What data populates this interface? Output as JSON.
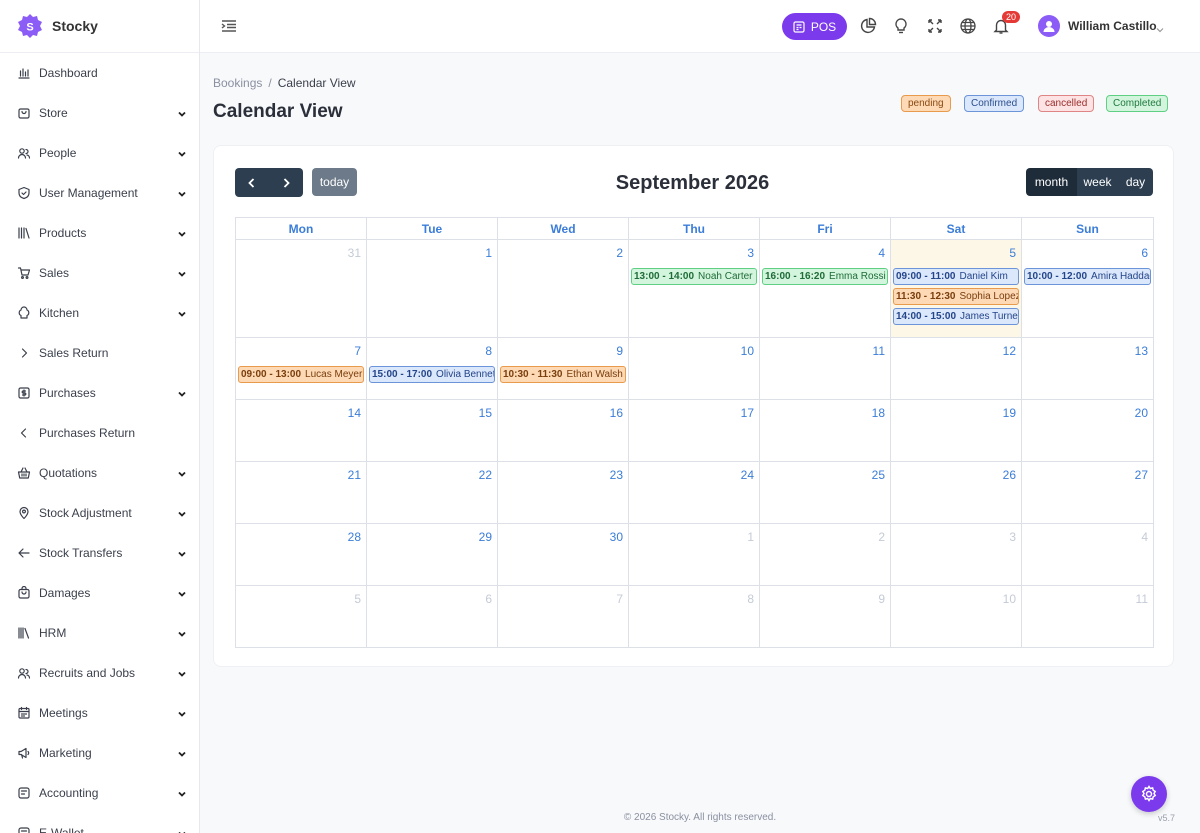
{
  "brand": {
    "name": "Stocky"
  },
  "sidebar": {
    "items": [
      {
        "label": "Dashboard",
        "icon": "chart-bar-icon",
        "chevron": ""
      },
      {
        "label": "Store",
        "icon": "store-icon",
        "chevron": "down"
      },
      {
        "label": "People",
        "icon": "people-icon",
        "chevron": "down"
      },
      {
        "label": "User Management",
        "icon": "shield-icon",
        "chevron": "down"
      },
      {
        "label": "Products",
        "icon": "books-icon",
        "chevron": "down"
      },
      {
        "label": "Sales",
        "icon": "cart-icon",
        "chevron": "down"
      },
      {
        "label": "Kitchen",
        "icon": "chef-hat-icon",
        "chevron": "down"
      },
      {
        "label": "Sales Return",
        "icon": "chevron-right-icon",
        "chevron": ""
      },
      {
        "label": "Purchases",
        "icon": "receipt-icon",
        "chevron": "down"
      },
      {
        "label": "Purchases Return",
        "icon": "chevron-left-icon",
        "chevron": ""
      },
      {
        "label": "Quotations",
        "icon": "basket-icon",
        "chevron": "down"
      },
      {
        "label": "Stock Adjustment",
        "icon": "location-pin-icon",
        "chevron": "down"
      },
      {
        "label": "Stock Transfers",
        "icon": "arrow-left-icon",
        "chevron": "down"
      },
      {
        "label": "Damages",
        "icon": "bag-icon",
        "chevron": "down"
      },
      {
        "label": "HRM",
        "icon": "library-icon",
        "chevron": "down"
      },
      {
        "label": "Recruits and Jobs",
        "icon": "people-icon",
        "chevron": "down"
      },
      {
        "label": "Meetings",
        "icon": "calendar-icon",
        "chevron": "down"
      },
      {
        "label": "Marketing",
        "icon": "megaphone-icon",
        "chevron": "down"
      },
      {
        "label": "Accounting",
        "icon": "wallet-icon",
        "chevron": "down"
      },
      {
        "label": "E-Wallet",
        "icon": "wallet-icon",
        "chevron": "down"
      }
    ]
  },
  "topbar": {
    "pos_label": "POS",
    "notifications_count": "20",
    "user_name": "William Castillo"
  },
  "breadcrumb": {
    "parent": "Bookings",
    "separator": "/",
    "current": "Calendar View"
  },
  "page": {
    "title": "Calendar View"
  },
  "legend": [
    {
      "label": "pending",
      "bg": "#fdd9b5",
      "border": "#e89a4d",
      "color": "#8a4a12"
    },
    {
      "label": "Confirmed",
      "bg": "#dbe7fb",
      "border": "#6c94d8",
      "color": "#2a4f8f"
    },
    {
      "label": "cancelled",
      "bg": "#fde3e3",
      "border": "#e08585",
      "color": "#9b2c2c"
    },
    {
      "label": "Completed",
      "bg": "#d3f5dd",
      "border": "#5fcf83",
      "color": "#1f7a3f"
    }
  ],
  "calendar": {
    "title": "September 2026",
    "today_label": "today",
    "views": [
      "month",
      "week",
      "day"
    ],
    "active_view": "month",
    "days_of_week": [
      "Mon",
      "Tue",
      "Wed",
      "Thu",
      "Fri",
      "Sat",
      "Sun"
    ],
    "weeks": [
      [
        {
          "n": "31",
          "other": true
        },
        {
          "n": "1"
        },
        {
          "n": "2"
        },
        {
          "n": "3",
          "events": [
            {
              "time": "13:00 - 14:00",
              "name": "Noah Carter",
              "status": "completed"
            }
          ]
        },
        {
          "n": "4",
          "events": [
            {
              "time": "16:00 - 16:20",
              "name": "Emma Rossi",
              "status": "completed"
            }
          ]
        },
        {
          "n": "5",
          "today": true,
          "events": [
            {
              "time": "09:00 - 11:00",
              "name": "Daniel Kim",
              "status": "confirmed"
            },
            {
              "time": "11:30 - 12:30",
              "name": "Sophia Lopez",
              "status": "pending"
            },
            {
              "time": "14:00 - 15:00",
              "name": "James Turner",
              "status": "confirmed"
            }
          ]
        },
        {
          "n": "6",
          "events": [
            {
              "time": "10:00 - 12:00",
              "name": "Amira Haddad",
              "status": "confirmed"
            }
          ]
        }
      ],
      [
        {
          "n": "7",
          "events": [
            {
              "time": "09:00 - 13:00",
              "name": "Lucas Meyer",
              "status": "pending"
            }
          ]
        },
        {
          "n": "8",
          "events": [
            {
              "time": "15:00 - 17:00",
              "name": "Olivia Bennett",
              "status": "confirmed"
            }
          ]
        },
        {
          "n": "9",
          "events": [
            {
              "time": "10:30 - 11:30",
              "name": "Ethan Walsh",
              "status": "pending"
            }
          ]
        },
        {
          "n": "10"
        },
        {
          "n": "11"
        },
        {
          "n": "12"
        },
        {
          "n": "13"
        }
      ],
      [
        {
          "n": "14"
        },
        {
          "n": "15"
        },
        {
          "n": "16"
        },
        {
          "n": "17"
        },
        {
          "n": "18"
        },
        {
          "n": "19"
        },
        {
          "n": "20"
        }
      ],
      [
        {
          "n": "21"
        },
        {
          "n": "22"
        },
        {
          "n": "23"
        },
        {
          "n": "24"
        },
        {
          "n": "25"
        },
        {
          "n": "26"
        },
        {
          "n": "27"
        }
      ],
      [
        {
          "n": "28"
        },
        {
          "n": "29"
        },
        {
          "n": "30"
        },
        {
          "n": "1",
          "other": true
        },
        {
          "n": "2",
          "other": true
        },
        {
          "n": "3",
          "other": true
        },
        {
          "n": "4",
          "other": true
        }
      ],
      [
        {
          "n": "5",
          "other": true
        },
        {
          "n": "6",
          "other": true
        },
        {
          "n": "7",
          "other": true
        },
        {
          "n": "8",
          "other": true
        },
        {
          "n": "9",
          "other": true
        },
        {
          "n": "10",
          "other": true
        },
        {
          "n": "11",
          "other": true
        }
      ]
    ]
  },
  "status_colors": {
    "completed": {
      "bg": "#d3f5dd",
      "border": "#5fcf83",
      "color": "#1f6b38"
    },
    "confirmed": {
      "bg": "#dbe7fb",
      "border": "#6c94d8",
      "color": "#23458a"
    },
    "pending": {
      "bg": "#fdd9b5",
      "border": "#e89a4d",
      "color": "#7a3d0c"
    }
  },
  "footer": {
    "copyright": "© 2026 Stocky. All rights reserved.",
    "version": "v5.7"
  }
}
